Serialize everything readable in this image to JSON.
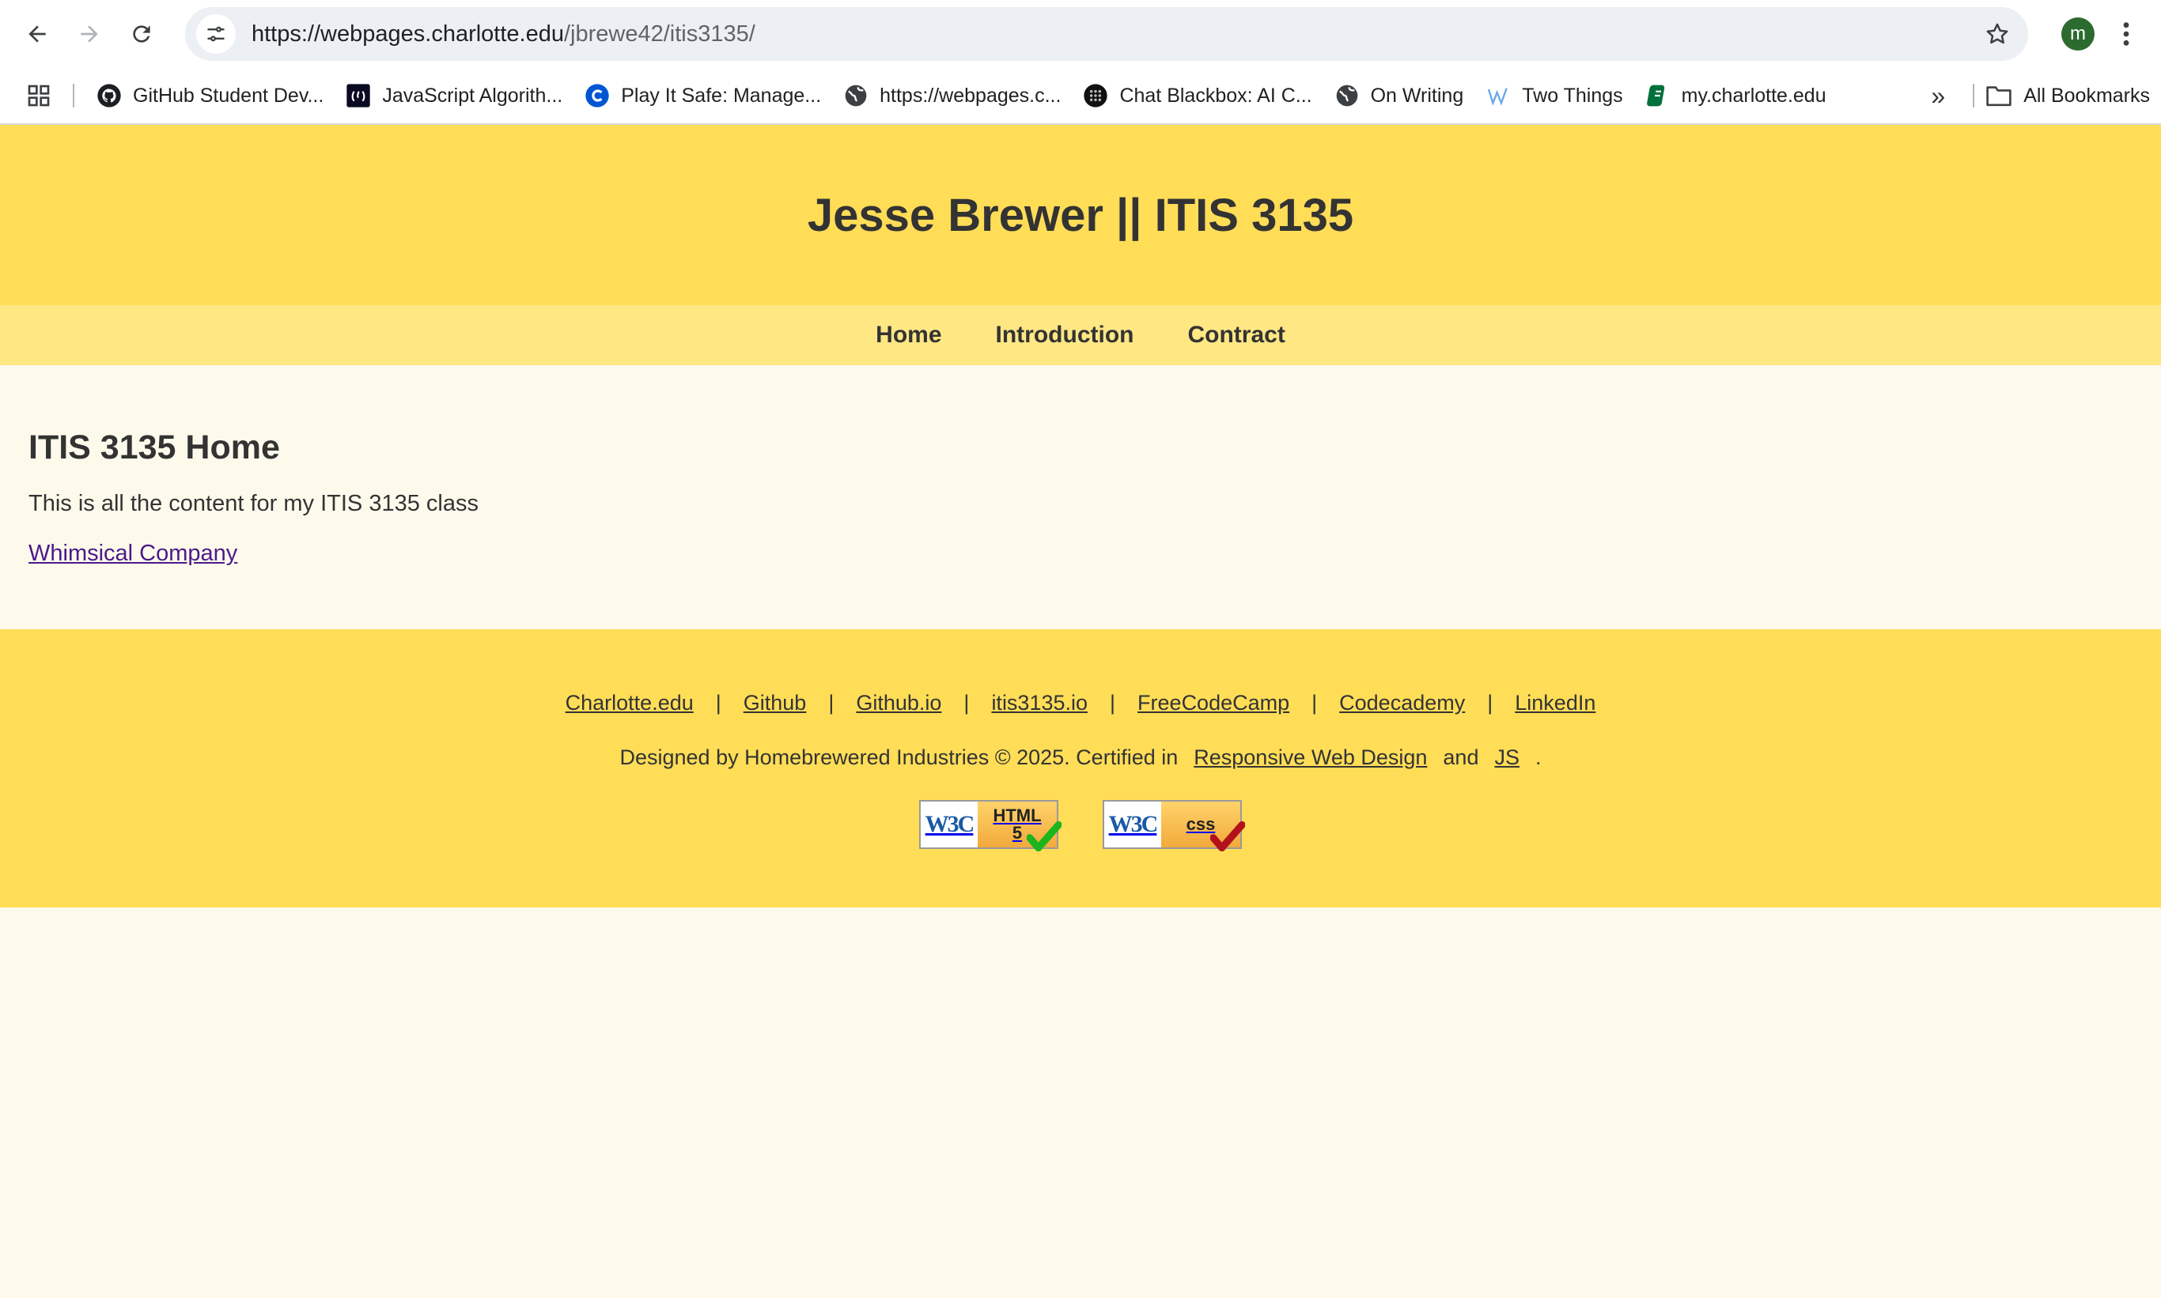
{
  "browser": {
    "url_host": "https://webpages.charlotte.edu",
    "url_path": "/jbrewe42/itis3135/",
    "profile_initial": "m",
    "bookmarks": [
      {
        "label": "GitHub Student Dev...",
        "icon": "github-icon"
      },
      {
        "label": "JavaScript Algorith...",
        "icon": "freecodecamp-icon"
      },
      {
        "label": "Play It Safe: Manage...",
        "icon": "coursera-icon"
      },
      {
        "label": "https://webpages.c...",
        "icon": "globe-icon"
      },
      {
        "label": "Chat Blackbox: AI C...",
        "icon": "blackbox-icon"
      },
      {
        "label": "On Writing",
        "icon": "globe-icon"
      },
      {
        "label": "Two Things",
        "icon": "wordpress-icon"
      },
      {
        "label": "my.charlotte.edu",
        "icon": "charlotte-icon"
      }
    ],
    "all_bookmarks_label": "All Bookmarks"
  },
  "header": {
    "title": "Jesse Brewer || ITIS 3135"
  },
  "nav": {
    "items": [
      "Home",
      "Introduction",
      "Contract"
    ]
  },
  "main": {
    "heading": "ITIS 3135 Home",
    "description": "This is all the content for my ITIS 3135 class",
    "link": "Whimsical Company"
  },
  "footer": {
    "links": [
      "Charlotte.edu",
      "Github",
      "Github.io",
      "itis3135.io",
      "FreeCodeCamp",
      "Codecademy",
      "LinkedIn"
    ],
    "separator": "|",
    "credit_prefix": "Designed by Homebrewered Industries © 2025. Certified in",
    "credit_link1": "Responsive Web Design",
    "credit_and": "and",
    "credit_link2": "JS",
    "credit_end": ".",
    "badge_html_w3c": "W3C",
    "badge_html_line1": "HTML",
    "badge_html_line2": "5",
    "badge_css_w3c": "W3C",
    "badge_css_text": "css"
  },
  "colors": {
    "header_bg": "#ffdd57",
    "nav_bg": "#ffe783",
    "page_bg": "#fdfaec",
    "visited_link": "#4b1a8a"
  }
}
